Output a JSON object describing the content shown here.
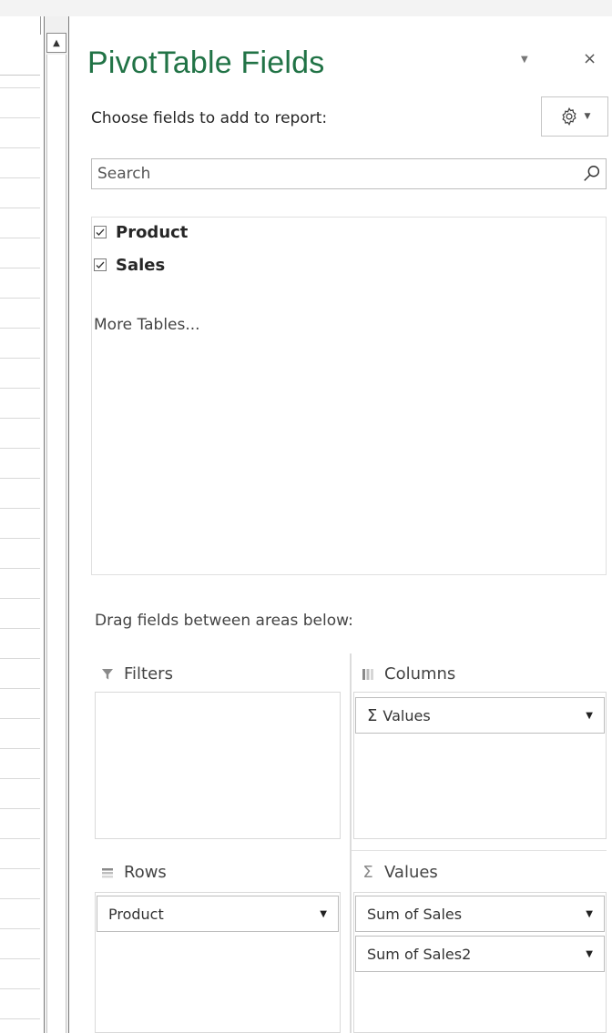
{
  "panel": {
    "title": "PivotTable Fields",
    "choose_label": "Choose fields to add to report:",
    "search_placeholder": "Search",
    "fields": [
      {
        "label": "Product",
        "checked": true
      },
      {
        "label": "Sales",
        "checked": true
      }
    ],
    "more_tables": "More Tables...",
    "drag_label": "Drag fields between areas below:"
  },
  "areas": {
    "filters": {
      "title": "Filters",
      "icon": "filter-icon"
    },
    "columns": {
      "title": "Columns",
      "icon": "columns-icon",
      "items": [
        "Values"
      ]
    },
    "rows": {
      "title": "Rows",
      "icon": "rows-icon",
      "items": [
        "Product"
      ]
    },
    "values": {
      "title": "Values",
      "icon": "sigma-icon",
      "items": [
        "Sum of Sales",
        "Sum of Sales2"
      ]
    }
  },
  "colors": {
    "title_green": "#217346",
    "border": "#bdbdbd"
  }
}
